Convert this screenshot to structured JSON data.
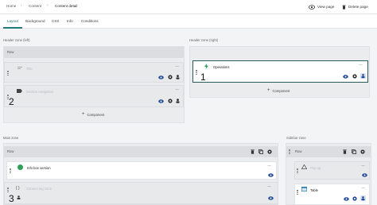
{
  "breadcrumbs": [
    "Home",
    "Content",
    "Content detail"
  ],
  "toolbar": {
    "view_page": "View page",
    "delete_page": "Delete page"
  },
  "tabs": [
    "Layout",
    "Background",
    "CSS",
    "Info",
    "Conditions"
  ],
  "active_tab": "Layout",
  "zones": {
    "header_left": {
      "label": "Header zone (left)",
      "row_label": "Row",
      "components": [
        {
          "title": "Title",
          "ghost": true
        },
        {
          "title": "Section navigation",
          "ghost": true,
          "selected": true,
          "marker": "2"
        }
      ],
      "add_label": "Component"
    },
    "header_right": {
      "label": "Header zone (right)",
      "components": [
        {
          "title": "Operations",
          "selected": true,
          "marker": "1"
        }
      ],
      "add_label": "Component"
    },
    "main": {
      "label": "Main zone",
      "row_label": "Row",
      "components": [
        {
          "title": "Info box version"
        },
        {
          "title": "Content tag zone",
          "ghost": true,
          "selected": true,
          "marker": "3",
          "icon_text": "{ }"
        }
      ]
    },
    "sidebar": {
      "label": "Sidebar zone",
      "row_label": "Row",
      "components": [
        {
          "title": "Pop up",
          "ghost": true
        },
        {
          "title": "Table"
        }
      ]
    }
  },
  "colors": {
    "accent": "#1f7a7a",
    "selected_border": "#2a5c5c",
    "green_badge": "#2e9e57"
  }
}
